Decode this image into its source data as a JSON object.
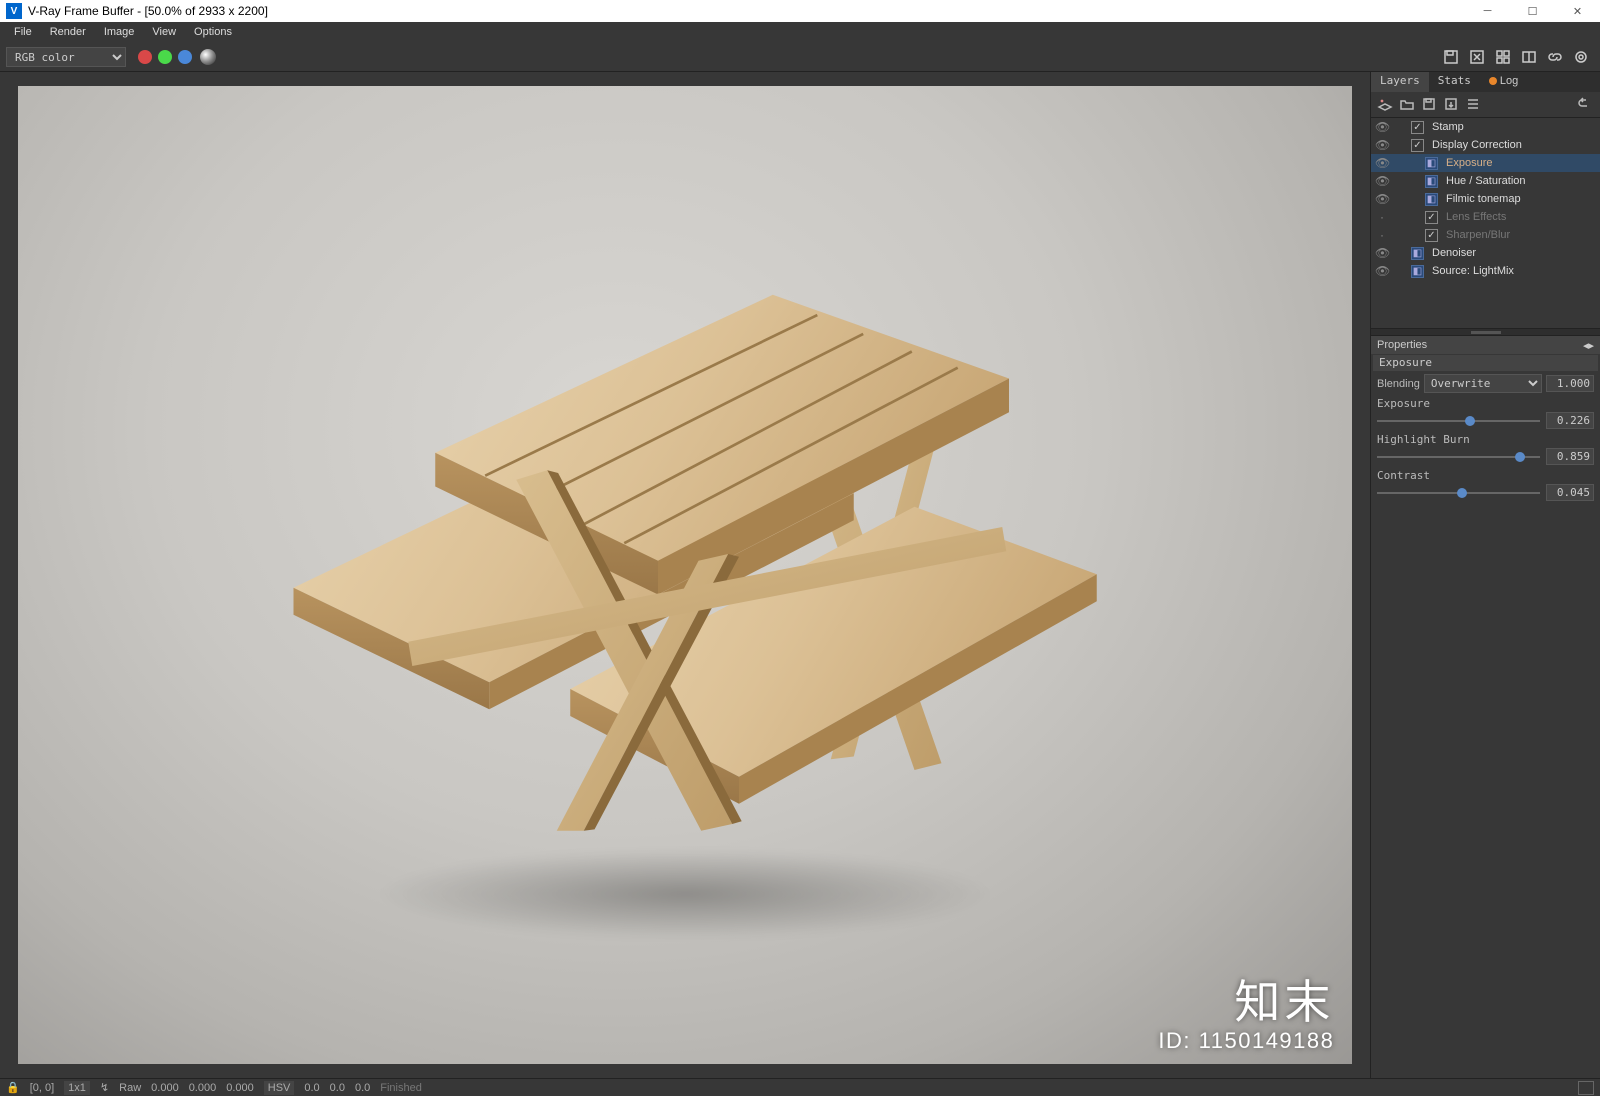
{
  "window": {
    "title": "V-Ray Frame Buffer - [50.0% of 2933 x 2200]"
  },
  "menu": {
    "items": [
      "File",
      "Render",
      "Image",
      "View",
      "Options"
    ]
  },
  "toolbar": {
    "channel": "RGB color"
  },
  "tabs": {
    "items": [
      "Layers",
      "Stats",
      "Log"
    ],
    "active": 0
  },
  "layers": {
    "items": [
      {
        "name": "Stamp",
        "eye": true,
        "icon": "c",
        "indent": 1,
        "dim": false
      },
      {
        "name": "Display Correction",
        "eye": true,
        "icon": "c",
        "indent": 1,
        "dim": false
      },
      {
        "name": "Exposure",
        "eye": true,
        "icon": "b",
        "indent": 2,
        "sel": true
      },
      {
        "name": "Hue / Saturation",
        "eye": true,
        "icon": "b",
        "indent": 2,
        "dim": false
      },
      {
        "name": "Filmic tonemap",
        "eye": true,
        "icon": "b",
        "indent": 2,
        "dim": false
      },
      {
        "name": "Lens Effects",
        "eye": false,
        "icon": "c",
        "indent": 2,
        "dim": true
      },
      {
        "name": "Sharpen/Blur",
        "eye": false,
        "icon": "c",
        "indent": 2,
        "dim": true
      },
      {
        "name": "Denoiser",
        "eye": true,
        "icon": "b",
        "indent": 1,
        "dim": false
      },
      {
        "name": "Source: LightMix",
        "eye": true,
        "icon": "b",
        "indent": 1,
        "dim": false
      }
    ]
  },
  "properties": {
    "header": "Properties",
    "name": "Exposure",
    "blending": {
      "label": "Blending",
      "mode": "Overwrite",
      "opacity": "1.000"
    },
    "sliders": [
      {
        "label": "Exposure",
        "value": "0.226",
        "pos": 57
      },
      {
        "label": "Highlight Burn",
        "value": "0.859",
        "pos": 88
      },
      {
        "label": "Contrast",
        "value": "0.045",
        "pos": 52
      }
    ]
  },
  "status": {
    "coords": "[0, 0]",
    "size": "1x1",
    "raw": "Raw",
    "r": "0.000",
    "g": "0.000",
    "b": "0.000",
    "mode": "HSV",
    "h": "0.0",
    "s": "0.0",
    "v": "0.0",
    "state": "Finished"
  },
  "watermark": {
    "l1": "知末",
    "l2": "ID: 1150149188"
  }
}
